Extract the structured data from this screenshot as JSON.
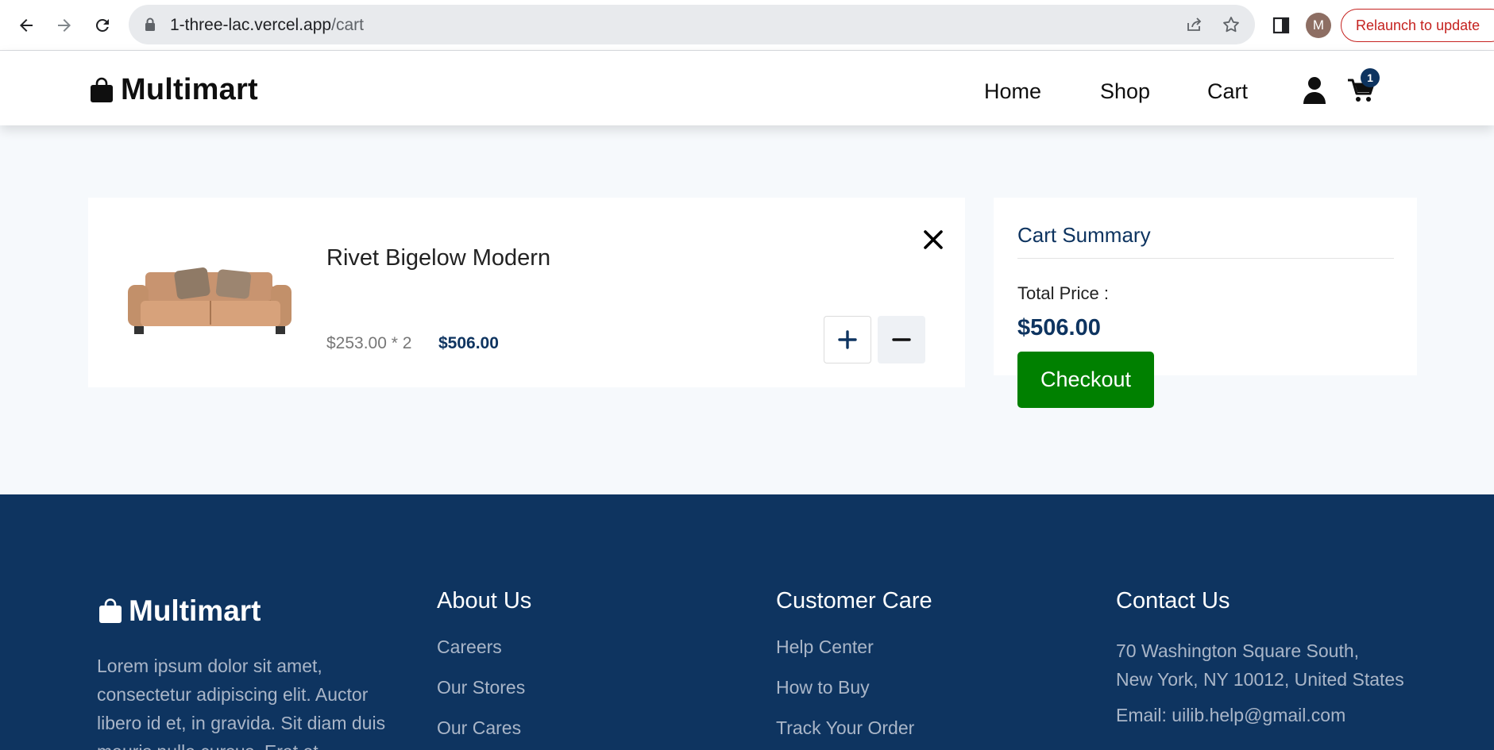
{
  "browser": {
    "url_host": "1-three-lac.vercel.app",
    "url_path": "/cart",
    "profile_initial": "M",
    "relaunch_label": "Relaunch to update"
  },
  "header": {
    "brand": "Multimart",
    "nav": [
      "Home",
      "Shop",
      "Cart"
    ],
    "cart_count": "1"
  },
  "cart": {
    "items": [
      {
        "name": "Rivet Bigelow Modern",
        "unit_price_qty": "$253.00 * 2",
        "total": "$506.00"
      }
    ]
  },
  "summary": {
    "title": "Cart Summary",
    "total_label": "Total Price :",
    "total_value": "$506.00",
    "checkout_label": "Checkout"
  },
  "footer": {
    "brand": "Multimart",
    "description": "Lorem ipsum dolor sit amet, consectetur adipiscing elit. Auctor libero id et, in gravida. Sit diam duis mauris nulla cursus. Erat et",
    "about": {
      "heading": "About Us",
      "links": [
        "Careers",
        "Our Stores",
        "Our Cares"
      ]
    },
    "care": {
      "heading": "Customer Care",
      "links": [
        "Help Center",
        "How to Buy",
        "Track Your Order"
      ]
    },
    "contact": {
      "heading": "Contact Us",
      "address_line1": "70 Washington Square South,",
      "address_line2": "New York, NY 10012, United States",
      "email": "Email: uilib.help@gmail.com"
    }
  }
}
